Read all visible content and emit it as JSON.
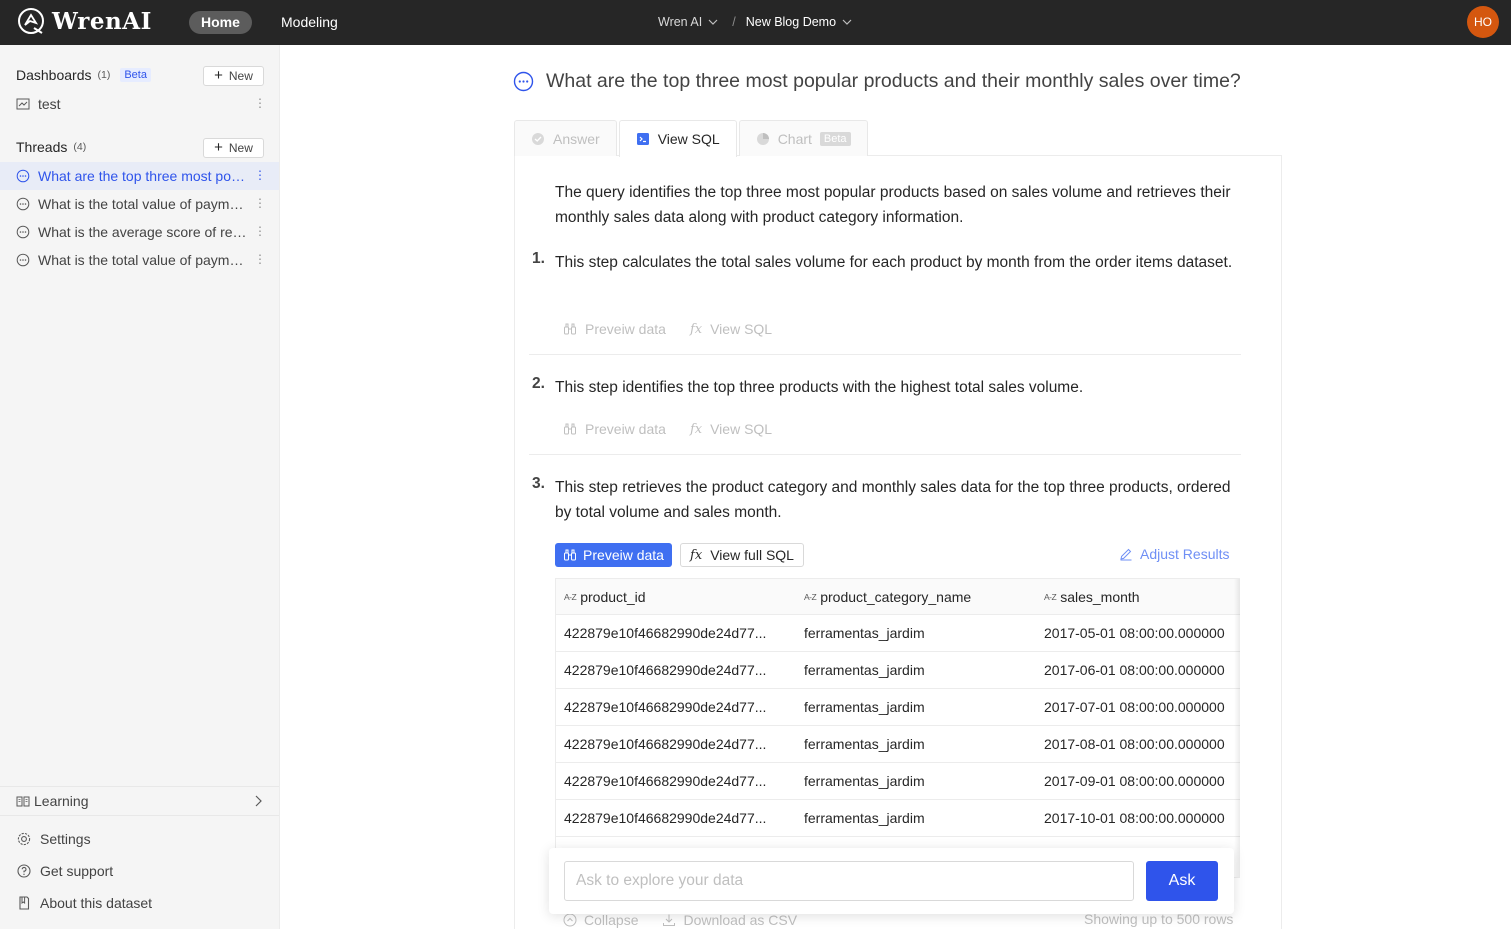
{
  "header": {
    "logo_text": "WrenAI",
    "nav": {
      "home": "Home",
      "modeling": "Modeling"
    },
    "breadcrumb": {
      "org": "Wren AI",
      "separator": "/",
      "project": "New Blog Demo"
    },
    "avatar_initials": "HO"
  },
  "sidebar": {
    "dashboards": {
      "label": "Dashboards",
      "count": "(1)",
      "badge": "Beta",
      "new_label": "New",
      "items": [
        "test"
      ]
    },
    "threads": {
      "label": "Threads",
      "count": "(4)",
      "new_label": "New",
      "items": [
        "What are the top three most popular products and their monthly sales over time?",
        "What is the total value of payments made by each customer?",
        "What is the average score of reviews?",
        "What is the total value of payments by payment type?"
      ]
    },
    "learning": "Learning",
    "footer": {
      "settings": "Settings",
      "support": "Get support",
      "about": "About this dataset"
    }
  },
  "main": {
    "question": "What are the top three most popular products and their monthly sales over time?",
    "tabs": {
      "answer": "Answer",
      "view_sql": "View SQL",
      "chart": "Chart",
      "chart_badge": "Beta"
    },
    "summary": "The query identifies the top three most popular products based on sales volume and retrieves their monthly sales data along with product category information.",
    "steps": [
      {
        "num": "1.",
        "text": "This step calculates the total sales volume for each product by month from the order items dataset.",
        "preview": "Preveiw data",
        "sql": "View SQL"
      },
      {
        "num": "2.",
        "text": "This step identifies the top three products with the highest total sales volume.",
        "preview": "Preveiw data",
        "sql": "View SQL"
      },
      {
        "num": "3.",
        "text": "This step retrieves the product category and monthly sales data for the top three products, ordered by total volume and sales month.",
        "preview": "Preveiw data",
        "sql": "View full SQL"
      }
    ],
    "adjust_results": "Adjust Results",
    "table": {
      "type_tag": "A-Z",
      "columns": [
        "product_id",
        "product_category_name",
        "sales_month"
      ],
      "rows": [
        [
          "422879e10f46682990de24d77...",
          "ferramentas_jardim",
          "2017-05-01 08:00:00.000000"
        ],
        [
          "422879e10f46682990de24d77...",
          "ferramentas_jardim",
          "2017-06-01 08:00:00.000000"
        ],
        [
          "422879e10f46682990de24d77...",
          "ferramentas_jardim",
          "2017-07-01 08:00:00.000000"
        ],
        [
          "422879e10f46682990de24d77...",
          "ferramentas_jardim",
          "2017-08-01 08:00:00.000000"
        ],
        [
          "422879e10f46682990de24d77...",
          "ferramentas_jardim",
          "2017-09-01 08:00:00.000000"
        ],
        [
          "422879e10f46682990de24d77...",
          "ferramentas_jardim",
          "2017-10-01 08:00:00.000000"
        ]
      ]
    },
    "ask": {
      "placeholder": "Ask to explore your data",
      "button": "Ask"
    },
    "footer": {
      "collapse": "Collapse",
      "download": "Download as CSV",
      "showing": "Showing up to 500 rows"
    }
  },
  "colors": {
    "accent": "#2f54eb",
    "topbar": "#262626",
    "avatar": "#d4570f"
  }
}
